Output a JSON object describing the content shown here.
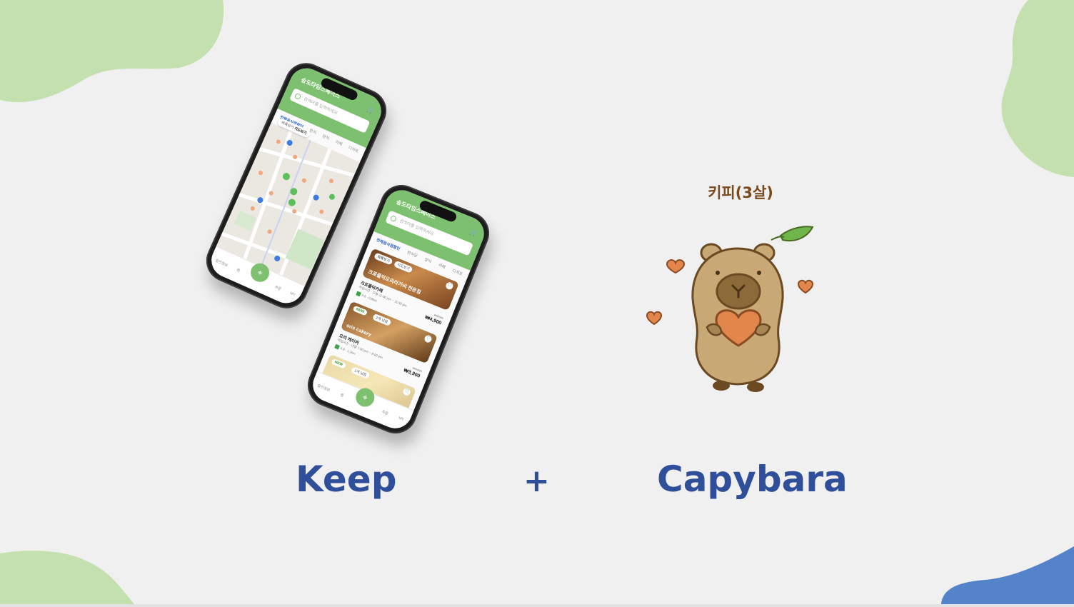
{
  "colors": {
    "background": "#f0f0f0",
    "blob_green": "#c5e0af",
    "blob_blue": "#5583c9",
    "app_green": "#7dc06f",
    "title_blue": "#2f4f9a",
    "capy_name_brown": "#7a4a1c"
  },
  "phone_map": {
    "location": "송도타임스페이스",
    "search_placeholder": "검색어를 입력하세요",
    "category": "전체음식점할인",
    "toggle_list": "목록보기",
    "toggle_map": "지도보기",
    "tabs": [
      "전체음식점할인",
      "한식",
      "양식",
      "카페",
      "디저트"
    ],
    "nav": [
      "할인정보",
      "찜",
      "픽업",
      "주문",
      "MY"
    ]
  },
  "phone_list": {
    "location": "송도타임스페이스",
    "search_placeholder": "검색어를 입력하세요",
    "tabs": [
      "전체음식점할인",
      "한식당",
      "양식",
      "카페",
      "디저트"
    ],
    "toggle_list": "목록보기",
    "toggle_map": "지도보기",
    "cards": [
      {
        "image_title": "크로플덕오리라가씨 천은점",
        "name": "크로플덕카페",
        "hours": "픽업시간 · 오늘 11:00 pm ~ 11:59 pm",
        "rating": "4.6",
        "distance": "0.8km",
        "old_price": "₩8,000",
        "price": "₩4,900"
      },
      {
        "badge": "NEW",
        "stock": "2개 남음",
        "image_title": "oris cakery",
        "name": "오리 케이커",
        "hours": "픽업시간 · 내일 7:00 pm ~ 8:00 pm",
        "rating": "4.8",
        "distance": "1.1km",
        "old_price": "₩6,000",
        "price": "₩3,900"
      },
      {
        "badge": "NEW",
        "stock": "1개 남음",
        "image_title": "밀당"
      }
    ],
    "nav": [
      "할인정보",
      "찜",
      "픽업",
      "주문",
      "MY"
    ]
  },
  "capybara": {
    "name": "키피(3살)",
    "illustration": "capybara-holding-heart"
  },
  "titles": {
    "left": "Keep",
    "plus": "+",
    "right": "Capybara"
  }
}
